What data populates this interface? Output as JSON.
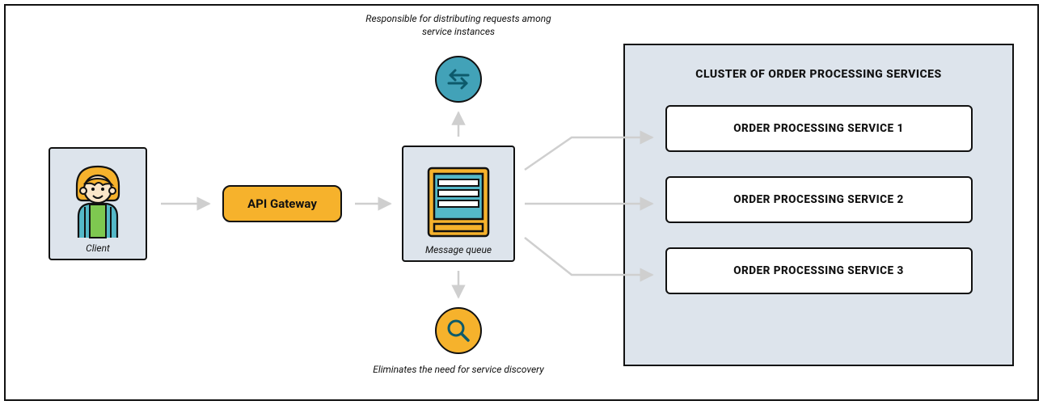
{
  "client": {
    "label": "Client"
  },
  "api_gateway": {
    "label": "API Gateway"
  },
  "message_queue": {
    "label": "Message queue"
  },
  "annotations": {
    "top": "Responsible for distributing requests among service instances",
    "bottom": "Eliminates the need for service discovery"
  },
  "cluster": {
    "title": "CLUSTER OF ORDER PROCESSING SERVICES",
    "services": [
      "ORDER PROCESSING SERVICE 1",
      "ORDER PROCESSING SERVICE 2",
      "ORDER PROCESSING SERVICE 3"
    ]
  }
}
